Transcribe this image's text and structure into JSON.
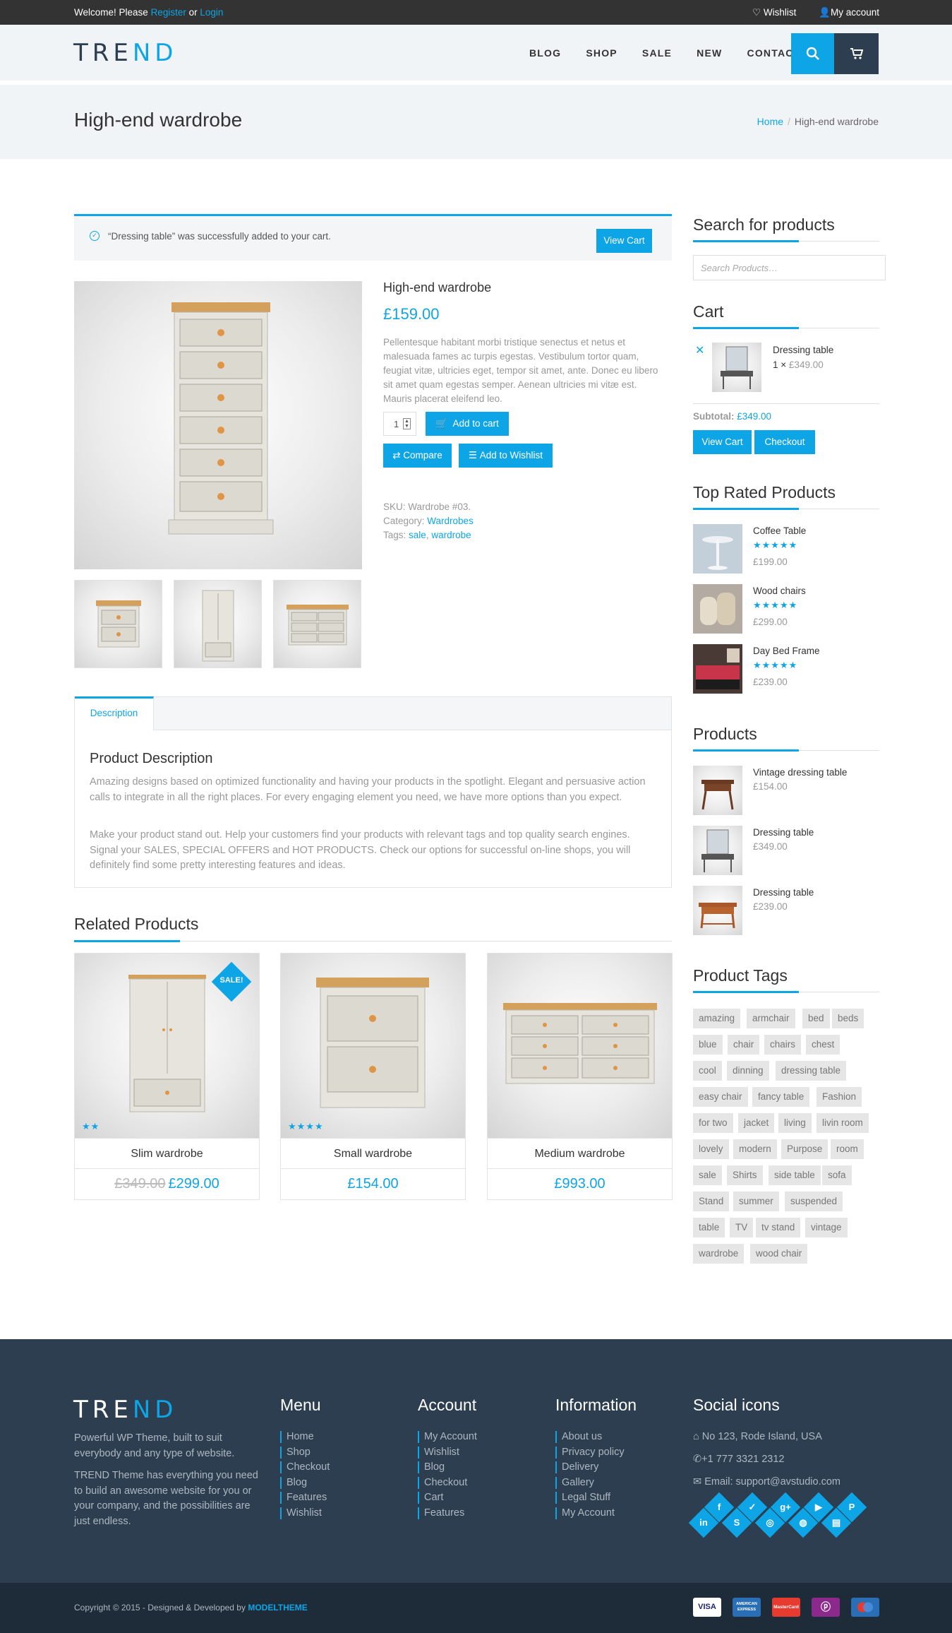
{
  "topbar": {
    "welcome": "Welcome! Please",
    "register": "Register",
    "or": "or",
    "login": "Login",
    "wishlist": "Wishlist",
    "account": "My account"
  },
  "header": {
    "logo_dark": "TRE",
    "logo_blue": "ND",
    "nav": [
      "BLOG",
      "SHOP",
      "SALE",
      "NEW",
      "CONTACT"
    ]
  },
  "page": {
    "title": "High-end wardrobe",
    "breadcrumb_home": "Home",
    "breadcrumb_current": "High-end wardrobe"
  },
  "notice": {
    "text": "“Dressing table” was successfully added to your cart.",
    "button": "View Cart"
  },
  "product": {
    "name": "High-end wardrobe",
    "price": "£159.00",
    "description": "Pellentesque habitant morbi tristique senectus et netus et malesuada fames ac turpis egestas. Vestibulum tortor quam, feugiat vitæ, ultricies eget, tempor sit amet, ante. Donec eu libero sit amet quam egestas semper. Aenean ultricies mi vitæ est. Mauris placerat eleifend leo.",
    "qty": "1",
    "add_to_cart": "Add to cart",
    "compare": "Compare",
    "add_to_wishlist": "Add to Wishlist",
    "sku_label": "SKU:",
    "sku": "Wardrobe #03.",
    "category_label": "Category:",
    "category": "Wardrobes",
    "tags_label": "Tags:",
    "tag1": "sale",
    "tag2": "wardrobe"
  },
  "tabs": {
    "description_tab": "Description",
    "heading": "Product Description",
    "p1": "Amazing designs based on optimized functionality and having your products in the spotlight. Elegant and persuasive action calls to integrate in all the right places. For every engaging element you need, we have more options than you expect.",
    "p2": "Make your product stand out. Help your customers find your products with relevant tags and top quality search engines. Signal your SALES, SPECIAL OFFERS and HOT PRODUCTS. Check our options for successful on-line shops, you will definitely find some pretty interesting features and ideas."
  },
  "related": {
    "heading": "Related Products",
    "sale_badge": "SALE!",
    "items": [
      {
        "name": "Slim wardrobe",
        "old_price": "£349.00",
        "price": "£299.00",
        "rating": 2
      },
      {
        "name": "Small wardrobe",
        "price": "£154.00",
        "rating": 4
      },
      {
        "name": "Medium wardrobe",
        "price": "£993.00",
        "rating": 0
      }
    ]
  },
  "sidebar": {
    "search_heading": "Search for products",
    "search_placeholder": "Search Products…",
    "cart_heading": "Cart",
    "cart_item": "Dressing table",
    "cart_qty": "1 ×",
    "cart_item_price": "£349.00",
    "subtotal_label": "Subtotal:",
    "subtotal": "£349.00",
    "view_cart": "View Cart",
    "checkout": "Checkout",
    "top_rated_heading": "Top Rated Products",
    "top_rated": [
      {
        "name": "Coffee Table",
        "price": "£199.00",
        "rating": 5
      },
      {
        "name": "Wood chairs",
        "price": "£299.00",
        "rating": 5
      },
      {
        "name": "Day Bed Frame",
        "price": "£239.00",
        "rating": 5
      }
    ],
    "products_heading": "Products",
    "products": [
      {
        "name": "Vintage dressing table",
        "price": "£154.00"
      },
      {
        "name": "Dressing table",
        "price": "£349.00"
      },
      {
        "name": "Dressing table",
        "price": "£239.00"
      }
    ],
    "tags_heading": "Product Tags",
    "tags": [
      "amazing",
      "armchair",
      "bed",
      "beds",
      "blue",
      "chair",
      "chairs",
      "chest",
      "cool",
      "dinning",
      "dressing table",
      "easy chair",
      "fancy table",
      "Fashion",
      "for two",
      "jacket",
      "living",
      "livin room",
      "lovely",
      "modern",
      "Purpose",
      "room",
      "sale",
      "Shirts",
      "side table",
      "sofa",
      "Stand",
      "summer",
      "suspended",
      "table",
      "TV",
      "tv stand",
      "vintage",
      "wardrobe",
      "wood chair"
    ]
  },
  "footer": {
    "about1": "Powerful WP Theme, built to suit everybody and any type of website.",
    "about2": "TREND Theme has everything you need to build an awesome website for you or your company, and the possibilities are just endless.",
    "menu_heading": "Menu",
    "menu": [
      "Home",
      "Shop",
      "Checkout",
      "Blog",
      "Features",
      "Wishlist"
    ],
    "account_heading": "Account",
    "account": [
      "My Account",
      "Wishlist",
      "Blog",
      "Checkout",
      "Cart",
      "Features"
    ],
    "info_heading": "Information",
    "info": [
      "About us",
      "Privacy policy",
      "Delivery",
      "Gallery",
      "Legal Stuff",
      "My Account"
    ],
    "social_heading": "Social icons",
    "address": "No 123, Rode Island, USA",
    "phone": "+1 777 3321 2312",
    "email": "Email: support@avstudio.com",
    "copyright": "Copyright © 2015 - Designed & Developed by",
    "brand": "MODELTHEME",
    "cards": [
      "VISA",
      "AMERICAN EXPRESS",
      "MasterCard",
      "",
      "Maestro"
    ]
  },
  "colors": {
    "accent": "#0ea5e6",
    "dark": "#2c3e50",
    "topbar": "#333333"
  }
}
